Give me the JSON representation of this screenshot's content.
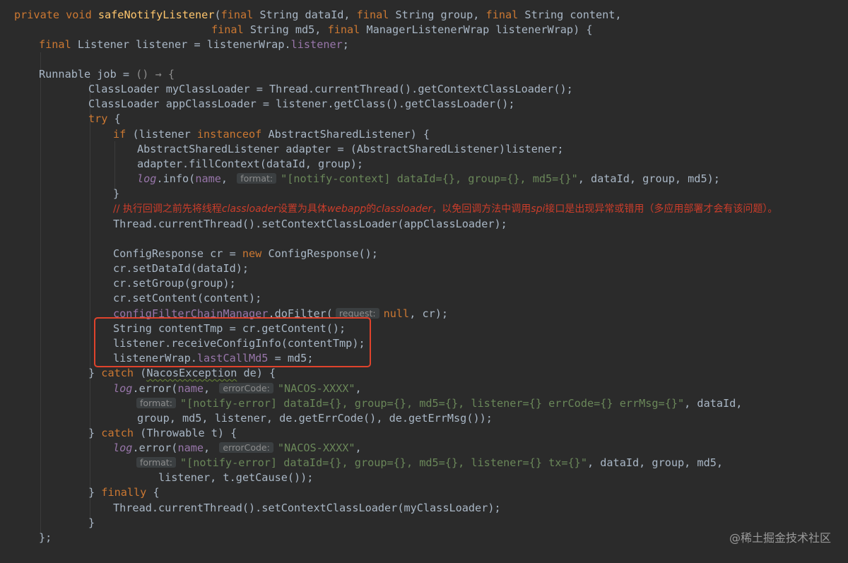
{
  "code": {
    "l1_a": "private void ",
    "l1_fn": "safeNotifyListener",
    "l1_b": "(",
    "l1_c": "final ",
    "l1_d": "String dataId, ",
    "l1_e": "final ",
    "l1_f": "String group, ",
    "l1_g": "final ",
    "l1_h": "String content,",
    "l2_a": "final ",
    "l2_b": "String md5, ",
    "l2_c": "final ",
    "l2_d": "ManagerListenerWrap listenerWrap) {",
    "l3_a": "final ",
    "l3_b": "Listener listener = listenerWrap.",
    "l3_c": "listener",
    "l3_d": ";",
    "l5_a": "Runnable job = ",
    "l5_b": "() → {",
    "l6": "ClassLoader myClassLoader = Thread.currentThread().getContextClassLoader();",
    "l7": "ClassLoader appClassLoader = listener.getClass().getClassLoader();",
    "l8_a": "try ",
    "l8_b": "{",
    "l9_a": "if ",
    "l9_b": "(listener ",
    "l9_c": "instanceof ",
    "l9_d": "AbstractSharedListener) {",
    "l10": "AbstractSharedListener adapter = (AbstractSharedListener)listener;",
    "l11": "adapter.fillContext(dataId, group);",
    "l12_a": "log",
    "l12_b": ".info(",
    "l12_c": "name",
    "l12_d": ", ",
    "l12_hint": "format:",
    "l12_e": "\"[notify-context] dataId={}, group={}, md5={}\"",
    "l12_f": ", dataId, group, md5);",
    "l13": "}",
    "l14_a": "// 执行回调之前先将线程",
    "l14_b": "classloader",
    "l14_c": "设置为具体",
    "l14_d": "webapp",
    "l14_e": "的",
    "l14_f": "classloader",
    "l14_g": "，以免回调方法中调用",
    "l14_h": "spi",
    "l14_i": "接口是出现异常或错用（多应用部署才会有该问题）。",
    "l15": "Thread.currentThread().setContextClassLoader(appClassLoader);",
    "l17_a": "ConfigResponse cr = ",
    "l17_b": "new ",
    "l17_c": "ConfigResponse();",
    "l18": "cr.setDataId(dataId);",
    "l19": "cr.setGroup(group);",
    "l20": "cr.setContent(content);",
    "l21_a": "configFilterChainManager",
    "l21_b": ".doFilter(",
    "l21_hint": "request:",
    "l21_c": "null",
    "l21_d": ", cr);",
    "l22": "String contentTmp = cr.getContent();",
    "l23": "listener.receiveConfigInfo(contentTmp);",
    "l24_a": "listenerWrap.",
    "l24_b": "lastCallMd5",
    "l24_c": " = md5;",
    "l25_a": "} ",
    "l25_b": "catch ",
    "l25_c": "(",
    "l25_d": "NacosException",
    "l25_e": " de) {",
    "l26_a": "log",
    "l26_b": ".error(",
    "l26_c": "name",
    "l26_d": ", ",
    "l26_hint": "errorCode:",
    "l26_e": "\"NACOS-XXXX\"",
    "l26_f": ",",
    "l27_hint": "format:",
    "l27_a": "\"[notify-error] dataId={}, group={}, md5={}, listener={} errCode={} errMsg={}\"",
    "l27_b": ", dataId,",
    "l28": "group, md5, listener, de.getErrCode(), de.getErrMsg());",
    "l29_a": "} ",
    "l29_b": "catch ",
    "l29_c": "(Throwable t) {",
    "l30_a": "log",
    "l30_b": ".error(",
    "l30_c": "name",
    "l30_d": ", ",
    "l30_hint": "errorCode:",
    "l30_e": "\"NACOS-XXXX\"",
    "l30_f": ",",
    "l31_hint": "format:",
    "l31_a": "\"[notify-error] dataId={}, group={}, md5={}, listener={} tx={}\"",
    "l31_b": ", dataId, group, md5,",
    "l32": "listener, t.getCause());",
    "l33_a": "} ",
    "l33_b": "finally ",
    "l33_c": "{",
    "l34": "Thread.currentThread().setContextClassLoader(myClassLoader);",
    "l35": "}",
    "l36": "};"
  },
  "watermark": "@稀土掘金技术社区",
  "colors": {
    "background": "#2b2b2b",
    "keyword": "#cc7832",
    "method": "#ffc66d",
    "field": "#9876aa",
    "string": "#6a8759",
    "comment": "#cc3d2b",
    "highlight_box": "#e0432c"
  }
}
